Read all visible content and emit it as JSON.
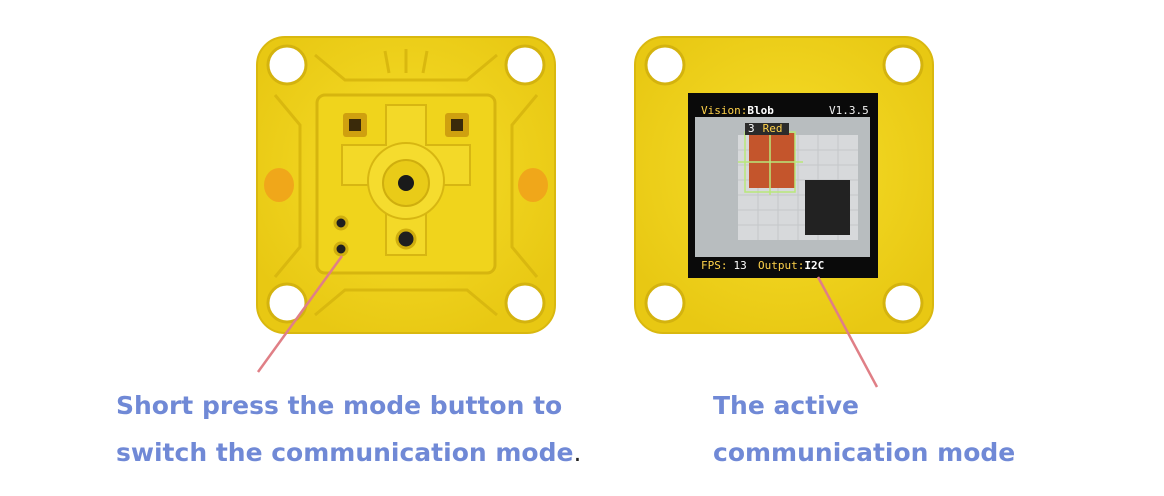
{
  "left_caption": {
    "line1": "Short press the mode button to",
    "line2": "switch the communication mode",
    "period": "."
  },
  "right_caption": {
    "line1": "The active",
    "line2": "communication mode"
  },
  "screen": {
    "vision_label": "Vision:",
    "vision_value": "Blob",
    "version": "V1.3.5",
    "blob_index": "3",
    "blob_color": "Red",
    "fps_label": "FPS:",
    "fps_value": "13",
    "output_label": "Output:",
    "output_value": "I2C"
  },
  "colors": {
    "module_yellow": "#f2d51d",
    "caption_blue": "#7089d6",
    "pointer_pink": "#e07f86",
    "highlight_green": "#b8e87a"
  }
}
